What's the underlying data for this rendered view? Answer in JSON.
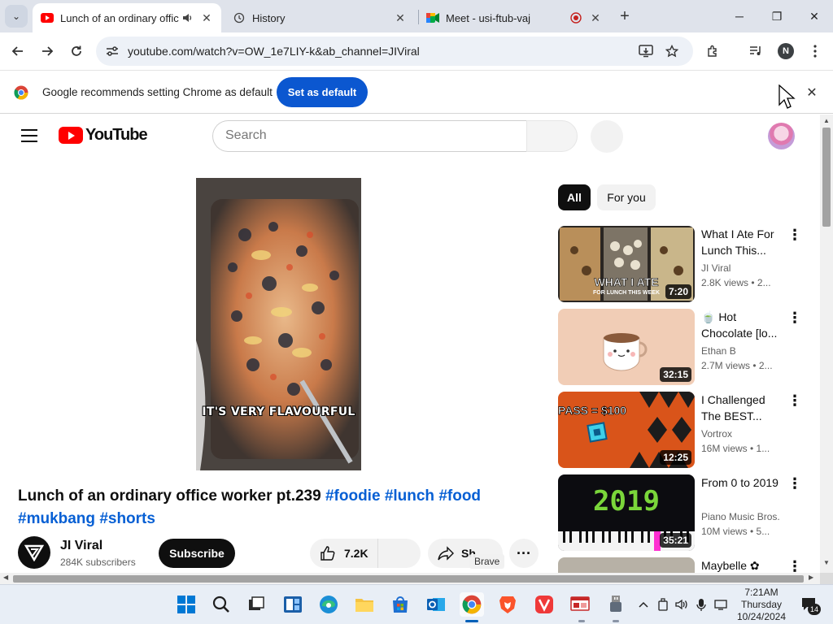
{
  "browser": {
    "tabs": [
      {
        "title": "Lunch of an ordinary office worker pt.239 #foodie #lunch #food",
        "active": true,
        "favicon": "youtube-icon",
        "audio": true
      },
      {
        "title": "History",
        "active": false,
        "favicon": "history-icon"
      },
      {
        "title": "Meet - usi-ftub-vaj",
        "active": false,
        "favicon": "meet-icon",
        "recording": true
      }
    ],
    "url": "youtube.com/watch?v=OW_1e7LIY-k&ab_channel=JIViral",
    "profile_initial": "N",
    "infobar": {
      "message": "Google recommends setting Chrome as default",
      "button": "Set as default"
    }
  },
  "youtube": {
    "logo_text": "YouTube",
    "search": {
      "placeholder": "Search"
    },
    "video": {
      "caption": "IT'S VERY FLAVOURFUL",
      "title_text": "Lunch of an ordinary office worker pt.239 ",
      "hashtags": [
        "#foodie",
        "#lunch",
        "#food",
        "#mukbang",
        "#shorts"
      ]
    },
    "channel": {
      "name": "JI Viral",
      "subscribers": "284K subscribers"
    },
    "subscribe_label": "Subscribe",
    "likes": "7.2K",
    "share_label": "Sh",
    "tooltip": "Brave",
    "chips": [
      {
        "label": "All",
        "selected": true
      },
      {
        "label": "For you",
        "selected": false
      }
    ],
    "recommendations": [
      {
        "title": "What I Ate For Lunch This...",
        "channel": "JI Viral",
        "views": "2.8K views • 2...",
        "duration": "7:20"
      },
      {
        "title": "🍵 Hot Chocolate [lo...",
        "channel": "Ethan B",
        "views": "2.7M views • 2...",
        "duration": "32:15"
      },
      {
        "title": "I Challenged The BEST...",
        "channel": "Vortrox",
        "views": "16M views • 1...",
        "duration": "12:25"
      },
      {
        "title": "From 0 to 2019",
        "channel": "Piano Music Bros.",
        "views": "10M views • 5...",
        "duration": "35:21"
      },
      {
        "title": "Maybelle ✿",
        "channel": "",
        "views": "",
        "duration": ""
      }
    ],
    "thumb_text": {
      "rec1": "WHAT I ATE",
      "rec1_sub": "FOR LUNCH THIS WEEK",
      "rec3": "PASS = $100",
      "rec4": "2019"
    }
  },
  "taskbar": {
    "time": "7:21AM",
    "day": "Thursday",
    "date": "10/24/2024",
    "notifications": "14"
  },
  "colors": {
    "youtube_red": "#ff0000",
    "chrome_blue": "#0b57d0",
    "hashtag_blue": "#065fd4"
  }
}
